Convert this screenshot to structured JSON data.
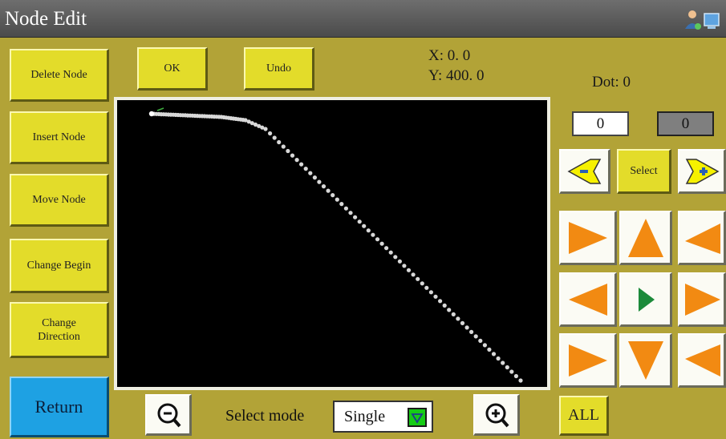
{
  "window": {
    "title": "Node Edit"
  },
  "left_buttons": {
    "delete_node": "Delete Node",
    "insert_node": "Insert Node",
    "move_node": "Move Node",
    "change_begin": "Change Begin",
    "change_direction": "Change\nDirection",
    "return": "Return"
  },
  "top_buttons": {
    "ok": "OK",
    "undo": "Undo"
  },
  "coords": {
    "x": "X: 0. 0",
    "y": "Y: 400. 0"
  },
  "dot": {
    "label": "Dot: 0"
  },
  "range": {
    "from": "0",
    "arrow": "->",
    "to": "0"
  },
  "nav": {
    "select": "Select",
    "all": "ALL"
  },
  "bottom": {
    "select_mode_label": "Select mode",
    "select_mode_value": "Single"
  },
  "colors": {
    "background": "#b2a337",
    "button": "#e3dc2a",
    "arrow": "#f28a12",
    "play": "#1c8a3a",
    "return": "#1ea1e3",
    "path": "#d8d8d8"
  },
  "icons": [
    "zoom-out-icon",
    "zoom-in-icon",
    "prev-node-icon",
    "next-node-icon",
    "user-icon",
    "monitor-icon"
  ]
}
